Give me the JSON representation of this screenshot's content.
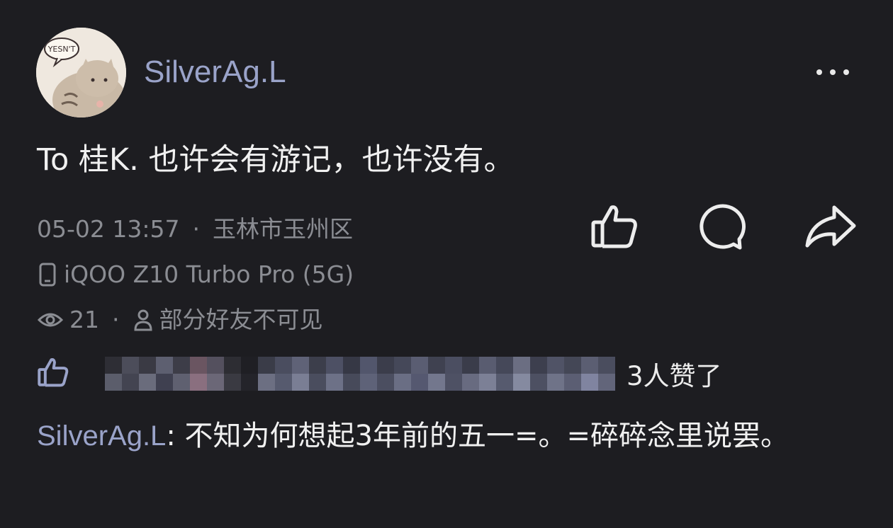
{
  "post": {
    "username": "SilverAg.L",
    "avatar_caption": "YESN'T",
    "text": "To  桂K.  也许会有游记，也许没有。",
    "time": "05-02 13:57",
    "separator": "·",
    "location": "玉林市玉州区",
    "device": "iQOO Z10 Turbo Pro (5G)",
    "views": "21",
    "visibility": "部分好友不可见",
    "likes_text": "3人赞了"
  },
  "comment": {
    "author": "SilverAg.L",
    "colon": ": ",
    "text": "不知为何想起3年前的五一=。=碎碎念里说罢。"
  },
  "icons": {
    "more": "more-dots-icon",
    "like": "thumbs-up-icon",
    "comment": "comment-bubble-icon",
    "share": "share-arrow-icon",
    "phone": "phone-icon",
    "eye": "eye-icon",
    "person": "person-icon"
  },
  "colors": {
    "background": "#1d1d21",
    "username": "#9aa3c9",
    "meta": "#8b8d93",
    "text": "#f0f0f0"
  }
}
